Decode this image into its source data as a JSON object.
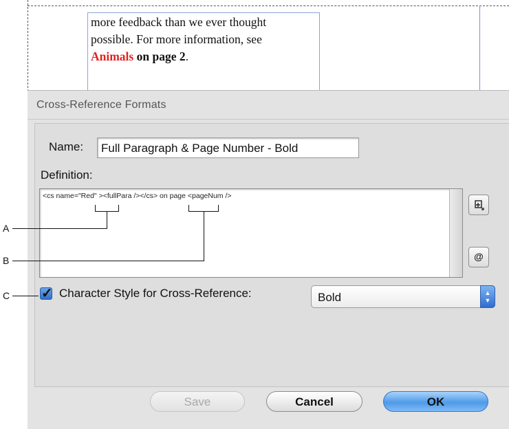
{
  "document": {
    "line1": "more feedback than we ever thought",
    "line2": "possible. For more information, see",
    "ref_red": "Animals",
    "ref_bold": " on page 2",
    "ref_end": "."
  },
  "dialog": {
    "title": "Cross-Reference Formats",
    "name_label": "Name:",
    "name_value": "Full Paragraph & Page Number - Bold",
    "definition_label": "Definition:",
    "definition_text": "<cs name=\"Red\" ><fullPara /></cs> on page <pageNum />",
    "insert_building_block_icon": "insert-building-block-icon",
    "insert_special_character_icon": "insert-special-character-icon",
    "char_style_checked": true,
    "char_style_label": "Character Style for Cross-Reference:",
    "char_style_value": "Bold",
    "buttons": {
      "save": "Save",
      "cancel": "Cancel",
      "ok": "OK"
    }
  },
  "callouts": {
    "a": "A",
    "b": "B",
    "c": "C"
  },
  "colors": {
    "ok_button": "#4f9ae8",
    "checkbox": "#2f6fc9",
    "red_text": "#e02222"
  }
}
